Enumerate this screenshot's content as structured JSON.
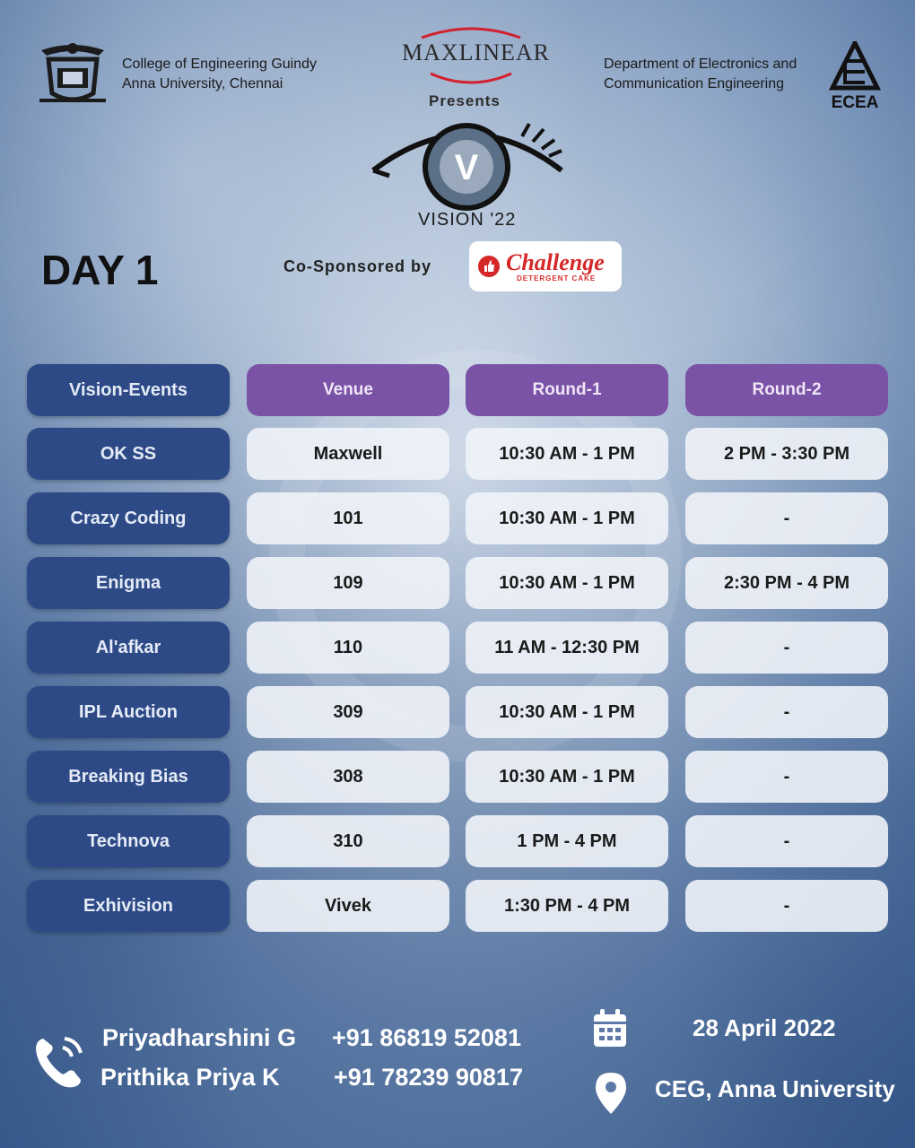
{
  "header": {
    "college_line1": "College of Engineering Guindy",
    "college_line2": "Anna University, Chennai",
    "sponsor": "MAXLINEAR",
    "presents": "Presents",
    "dept_line1": "Department of Electronics and",
    "dept_line2": "Communication Engineering",
    "dept_logo_text": "ECEA",
    "vision_mark": "V",
    "event_title": "VISION '22"
  },
  "day_label": "DAY 1",
  "cosponsor": {
    "label": "Co-Sponsored by",
    "brand": "Challenge",
    "brand_sub": "DETERGENT CAKE"
  },
  "table": {
    "headers": [
      "Vision-Events",
      "Venue",
      "Round-1",
      "Round-2"
    ],
    "rows": [
      {
        "event": "OK SS",
        "venue": "Maxwell",
        "round1": "10:30 AM - 1 PM",
        "round2": "2 PM - 3:30 PM"
      },
      {
        "event": "Crazy Coding",
        "venue": "101",
        "round1": "10:30 AM - 1 PM",
        "round2": "-"
      },
      {
        "event": "Enigma",
        "venue": "109",
        "round1": "10:30 AM - 1 PM",
        "round2": "2:30 PM - 4 PM"
      },
      {
        "event": "Al'afkar",
        "venue": "110",
        "round1": "11 AM - 12:30 PM",
        "round2": "-"
      },
      {
        "event": "IPL Auction",
        "venue": "309",
        "round1": "10:30 AM - 1 PM",
        "round2": "-"
      },
      {
        "event": "Breaking Bias",
        "venue": "308",
        "round1": "10:30 AM - 1 PM",
        "round2": "-"
      },
      {
        "event": "Technova",
        "venue": "310",
        "round1": "1 PM - 4 PM",
        "round2": "-"
      },
      {
        "event": "Exhivision",
        "venue": "Vivek",
        "round1": "1:30 PM - 4 PM",
        "round2": "-"
      }
    ]
  },
  "contacts": [
    {
      "name": "Priyadharshini G",
      "phone": "+91 86819 52081"
    },
    {
      "name": "Prithika Priya K",
      "phone": "+91 78239 90817"
    }
  ],
  "event_date": "28 April 2022",
  "event_place": "CEG, Anna University",
  "colors": {
    "event_cell": "#2e4a86",
    "header_cell": "#7a52a6",
    "value_cell": "#f0f3f8",
    "challenge_red": "#d62828"
  },
  "icons": [
    "ceg-emblem-icon",
    "maxlinear-arc-icon",
    "eye-logo-icon",
    "ecea-logo-icon",
    "thumbs-up-icon",
    "phone-icon",
    "calendar-icon",
    "location-pin-icon"
  ]
}
